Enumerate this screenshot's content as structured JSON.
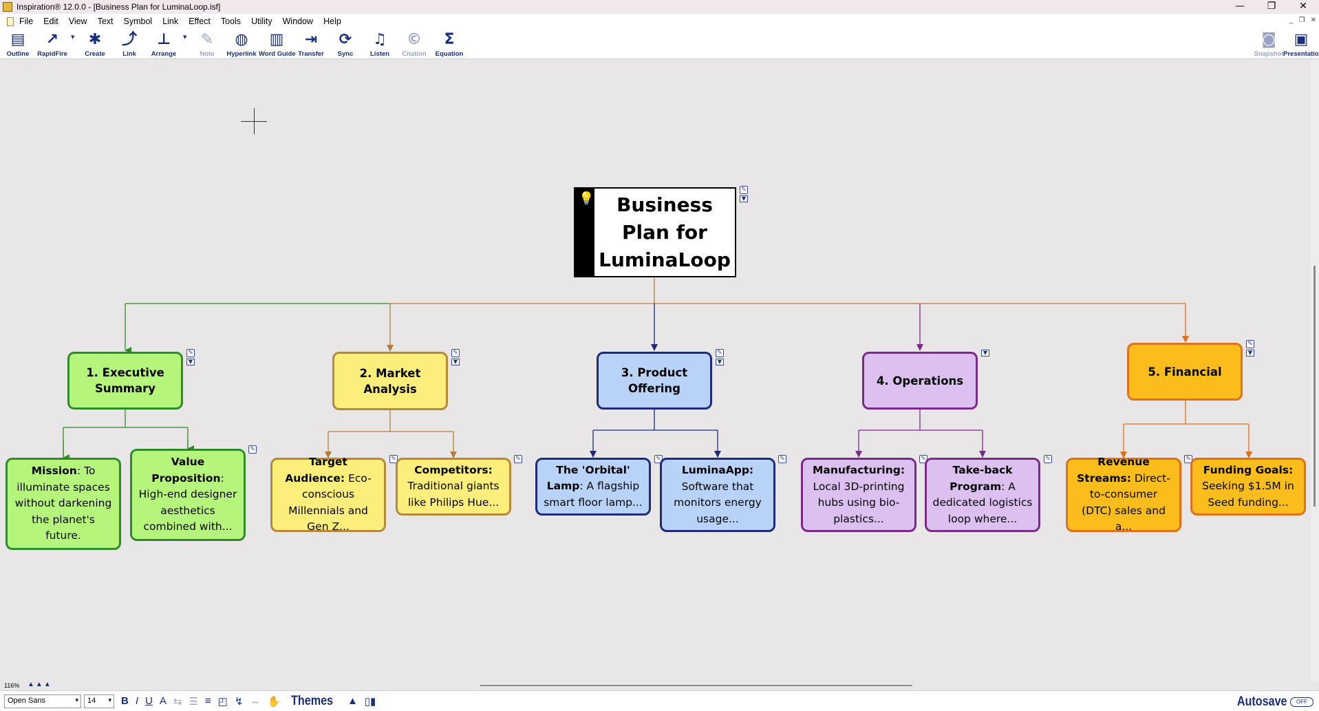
{
  "window": {
    "title": "Inspiration® 12.0.0 - [Business Plan for LuminaLoop.isf]",
    "controls": [
      "—",
      "❐",
      "✕"
    ]
  },
  "menu": [
    "File",
    "Edit",
    "View",
    "Text",
    "Symbol",
    "Link",
    "Effect",
    "Tools",
    "Utility",
    "Window",
    "Help"
  ],
  "toolbar": {
    "outline": "Outline",
    "rapidfire": "RapidFire",
    "create": "Create",
    "link": "Link",
    "arrange": "Arrange",
    "note": "Note",
    "hyperlink": "Hyperlink",
    "word_guide": "Word Guide",
    "transfer": "Transfer",
    "sync": "Sync",
    "listen": "Listen",
    "citation": "Citation",
    "equation": "Equation",
    "snapshot": "Snapshot",
    "presentation": "Presentation"
  },
  "diagram": {
    "root": "Business Plan for LuminaLoop",
    "colors": {
      "green": "#b6f57c",
      "green_border": "#2f8a2a",
      "yellow": "#fbee7a",
      "yellow_border": "#b38a3c",
      "blue": "#b8d3f7",
      "blue_border": "#1f2a7a",
      "purple": "#dcc0f0",
      "purple_border": "#7a2a86",
      "orange": "#fbbd1c",
      "orange_border": "#e0701a"
    },
    "main": [
      {
        "label": "1. Executive Summary"
      },
      {
        "label": "2. Market Analysis"
      },
      {
        "label": "3. Product Offering"
      },
      {
        "label": "4. Operations"
      },
      {
        "label": "5. Financial"
      }
    ],
    "subs": [
      {
        "title": "Mission",
        "sep": ": ",
        "text": "To illuminate spaces without darkening the planet's future."
      },
      {
        "title": "Value Proposition",
        "sep": ": ",
        "text": "High-end designer aesthetics combined with..."
      },
      {
        "title": "Target Audience:",
        "sep": " ",
        "text": "Eco-conscious Millennials and Gen Z..."
      },
      {
        "title": "Competitors:",
        "sep": " ",
        "text": "Traditional giants like Philips Hue..."
      },
      {
        "title": "The 'Orbital' Lamp",
        "sep": ": ",
        "text": "A flagship smart floor lamp..."
      },
      {
        "title": "LuminaApp:",
        "sep": " ",
        "text": "Software that monitors energy usage..."
      },
      {
        "title": "Manufacturing:",
        "sep": " ",
        "text": "Local 3D-printing hubs using bio-plastics..."
      },
      {
        "title": "Take-back Program",
        "sep": ": ",
        "text": "A dedicated logistics loop where..."
      },
      {
        "title": "Revenue Streams:",
        "sep": " ",
        "text": "Direct-to-consumer (DTC) sales and a..."
      },
      {
        "title": "Funding Goals:",
        "sep": " ",
        "text": "Seeking $1.5M in Seed funding..."
      }
    ]
  },
  "status": {
    "zoom": "116%",
    "font": "Open Sans",
    "size": "14",
    "themes": "Themes",
    "autosave": "Autosave",
    "autosave_state": "OFF"
  }
}
